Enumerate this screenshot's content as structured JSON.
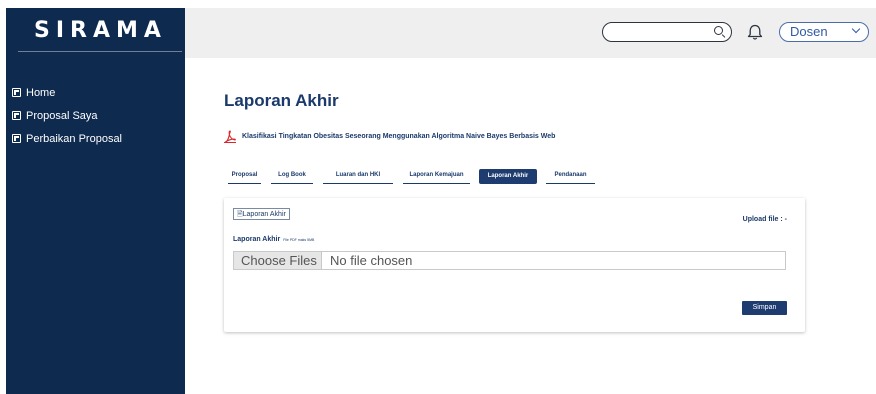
{
  "app": {
    "brand": "SIRAMA"
  },
  "sidebar": {
    "items": [
      {
        "label": "Home"
      },
      {
        "label": "Proposal Saya"
      },
      {
        "label": "Perbaikan Proposal"
      }
    ]
  },
  "header": {
    "search": {
      "value": "",
      "icon": "search-icon"
    },
    "notification_icon": "bell-icon",
    "role_select": {
      "value": "Dosen"
    }
  },
  "main": {
    "title": "Laporan Akhir",
    "document": {
      "icon": "pdf-icon",
      "title": "Klasifikasi Tingkatan Obesitas Seseorang Menggunakan Algoritma Naive Bayes Berbasis Web"
    },
    "tabs": [
      {
        "label": "Proposal",
        "active": false
      },
      {
        "label": "Log Book",
        "active": false
      },
      {
        "label": "Luaran dan HKI",
        "active": false
      },
      {
        "label": "Laporan Kemajuan",
        "active": false
      },
      {
        "label": "Laporan Akhir",
        "active": true
      },
      {
        "label": "Pendanaan",
        "active": false
      }
    ],
    "form": {
      "file_link": "Laporan Akhir",
      "upload_status": "Upload file : -",
      "field_label": "Laporan Akhir",
      "field_hint": "File PDF maks 5MB",
      "choose_button": "Choose Files",
      "no_file_text": "No file chosen",
      "save_button": "Simpan"
    }
  },
  "colors": {
    "sidebar_bg": "#0e2a4f",
    "accent": "#1e3c70",
    "topbar_bg": "#efefef",
    "link_blue": "#2f5aa5"
  }
}
